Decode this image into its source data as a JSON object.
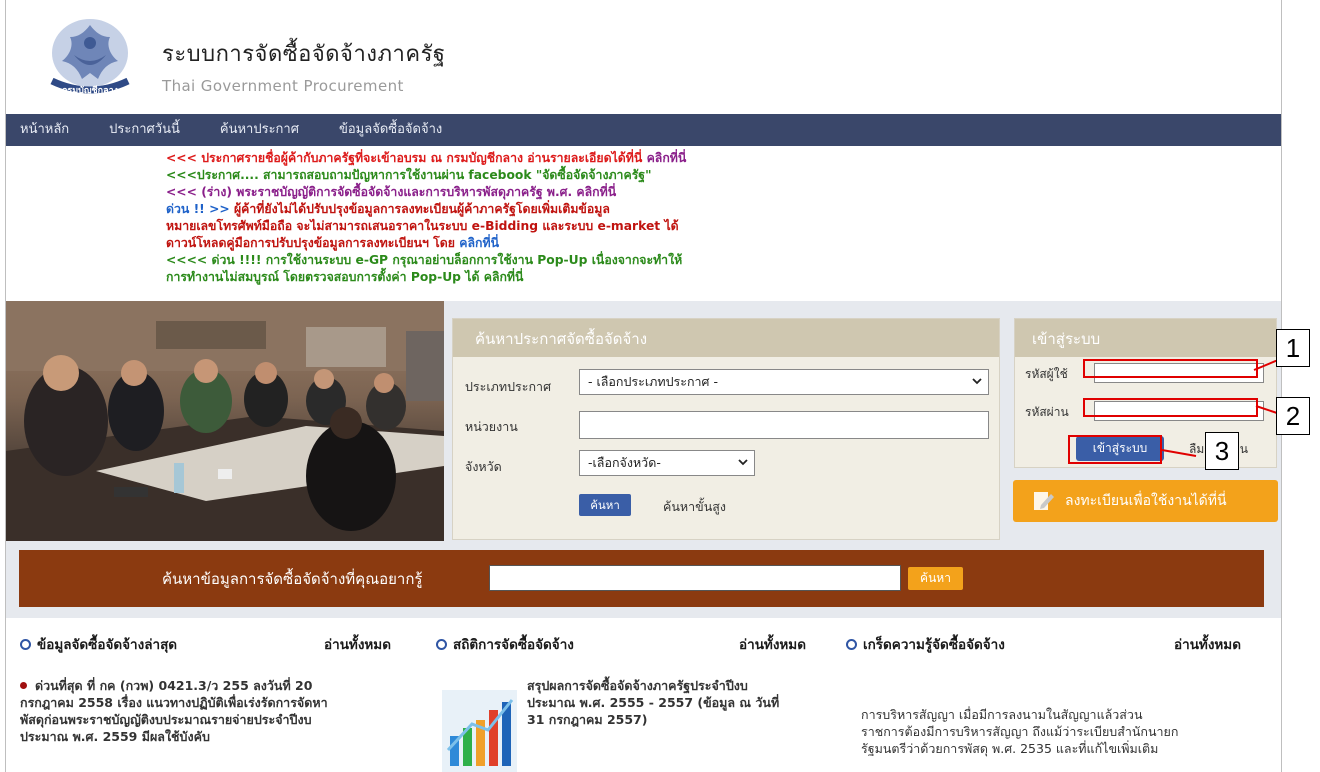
{
  "header": {
    "title": "ระบบการจัดซื้อจัดจ้างภาครัฐ",
    "subtitle": "Thai Government Procurement"
  },
  "nav": {
    "items": [
      "หน้าหลัก",
      "ประกาศวันนี้",
      "ค้นหาประกาศ",
      "ข้อมูลจัดซื้อจัดจ้าง"
    ]
  },
  "news": {
    "lines": [
      {
        "segments": [
          {
            "text": "<<< ประกาศรายชื่อผู้ค้ากับภาครัฐที่จะเข้าอบรม ณ กรมบัญชีกลาง อ่านรายละเอียดได้ที่นี่ ",
            "color": "#dd1a1a"
          },
          {
            "text": "คลิกที่นี่",
            "color": "#8a1f8a"
          }
        ]
      },
      {
        "segments": [
          {
            "text": "<<<ประกาศ.... สามารถสอบถามปัญหาการใช้งานผ่าน facebook \"จัดซื้อจัดจ้างภาครัฐ\"",
            "color": "#2b8a1a"
          }
        ]
      },
      {
        "segments": [
          {
            "text": "<<< (ร่าง) พระราชบัญญัติการจัดซื้อจัดจ้างและการบริหารพัสดุภาครัฐ พ.ศ. คลิกที่นี่",
            "color": "#8a1f8a"
          }
        ]
      },
      {
        "segments": [
          {
            "text": "ด่วน !! >> ",
            "color": "#1f62c9"
          },
          {
            "text": "ผู้ค้าที่ยังไม่ได้ปรับปรุงข้อมูลการลงทะเบียนผู้ค้าภาครัฐโดยเพิ่มเติมข้อมูล",
            "color": "#c0130f"
          }
        ]
      },
      {
        "segments": [
          {
            "text": "หมายเลขโทรศัพท์มือถือ จะไม่สามารถเสนอราคาในระบบ e-Bidding และระบบ e-market ได้",
            "color": "#c0130f"
          }
        ]
      },
      {
        "segments": [
          {
            "text": "ดาวน์โหลดคู่มือการปรับปรุงข้อมูลการลงทะเบียนฯ โดย ",
            "color": "#c0130f"
          },
          {
            "text": "คลิกที่นี่",
            "color": "#1f62c9"
          }
        ]
      },
      {
        "segments": [
          {
            "text": "<<<< ด่วน !!!! การใช้งานระบบ e-GP กรุณาอย่าบล็อกการใช้งาน Pop-Up เนื่องจากจะทำให้",
            "color": "#2b8a1a"
          }
        ]
      },
      {
        "segments": [
          {
            "text": "การทำงานไม่สมบูรณ์ โดยตรวจสอบการตั้งค่า Pop-Up ได้ คลิกที่นี่",
            "color": "#2b8a1a"
          }
        ]
      }
    ]
  },
  "search_panel": {
    "title": "ค้นหาประกาศจัดซื้อจัดจ้าง",
    "type_label": "ประเภทประกาศ",
    "type_value": "- เลือกประเภทประกาศ -",
    "agency_label": "หน่วยงาน",
    "agency_value": "",
    "province_label": "จังหวัด",
    "province_value": "-เลือกจังหวัด-",
    "search_button": "ค้นหา",
    "advanced_link": "ค้นหาขั้นสูง"
  },
  "login_panel": {
    "title": "เข้าสู่ระบบ",
    "username_label": "รหัสผู้ใช้",
    "username_value": "",
    "password_label": "รหัสผ่าน",
    "password_value": "",
    "login_button": "เข้าสู่ระบบ",
    "forgot_link": "ลืมรหัสผ่าน"
  },
  "register_button": "ลงทะเบียนเพื่อใช้งานได้ที่นี่",
  "search_bar": {
    "label": "ค้นหาข้อมูลการจัดซื้อจัดจ้างที่คุณอยากรู้",
    "input_value": "",
    "button": "ค้นหา"
  },
  "columns": [
    {
      "title": "ข้อมูลจัดซื้อจัดจ้างล่าสุด",
      "read_all": "อ่านทั้งหมด",
      "lines": [
        "ด่วนที่สุด ที่ กค (กวพ) 0421.3/ว 255 ลงวันที่ 20",
        "กรกฎาคม 2558 เรื่อง แนวทางปฏิบัติเพื่อเร่งรัดการจัดหา",
        "พัสดุก่อนพระราชบัญญัติงบประมาณรายจ่ายประจำปีงบ",
        "ประมาณ พ.ศ. 2559 มีผลใช้บังคับ"
      ]
    },
    {
      "title": "สถิติการจัดซื้อจัดจ้าง",
      "read_all": "อ่านทั้งหมด",
      "lines": [
        "สรุปผลการจัดซื้อจัดจ้างภาครัฐประจำปีงบ",
        "ประมาณ พ.ศ. 2555 - 2557 (ข้อมูล ณ วันที่",
        "31 กรกฎาคม 2557)"
      ]
    },
    {
      "title": "เกร็ดความรู้จัดซื้อจัดจ้าง",
      "read_all": "อ่านทั้งหมด",
      "lines": [
        "การบริหารสัญญา    เมื่อมีการลงนามในสัญญาแล้วส่วน",
        "ราชการต้องมีการบริหารสัญญา ถึงแม้ว่าระเบียบสำนักนายก",
        "รัฐมนตรีว่าด้วยการพัสดุ พ.ศ. 2535 และที่แก้ไขเพิ่มเติม"
      ]
    }
  ],
  "callouts": [
    "1",
    "2",
    "3"
  ],
  "colors": {
    "nav": "#3a476a",
    "panel_header": "#cfc7b0",
    "button_blue": "#3a5ea7",
    "orange": "#f3a21b",
    "search_bar": "#8b3a10",
    "callout": "#e00000"
  }
}
